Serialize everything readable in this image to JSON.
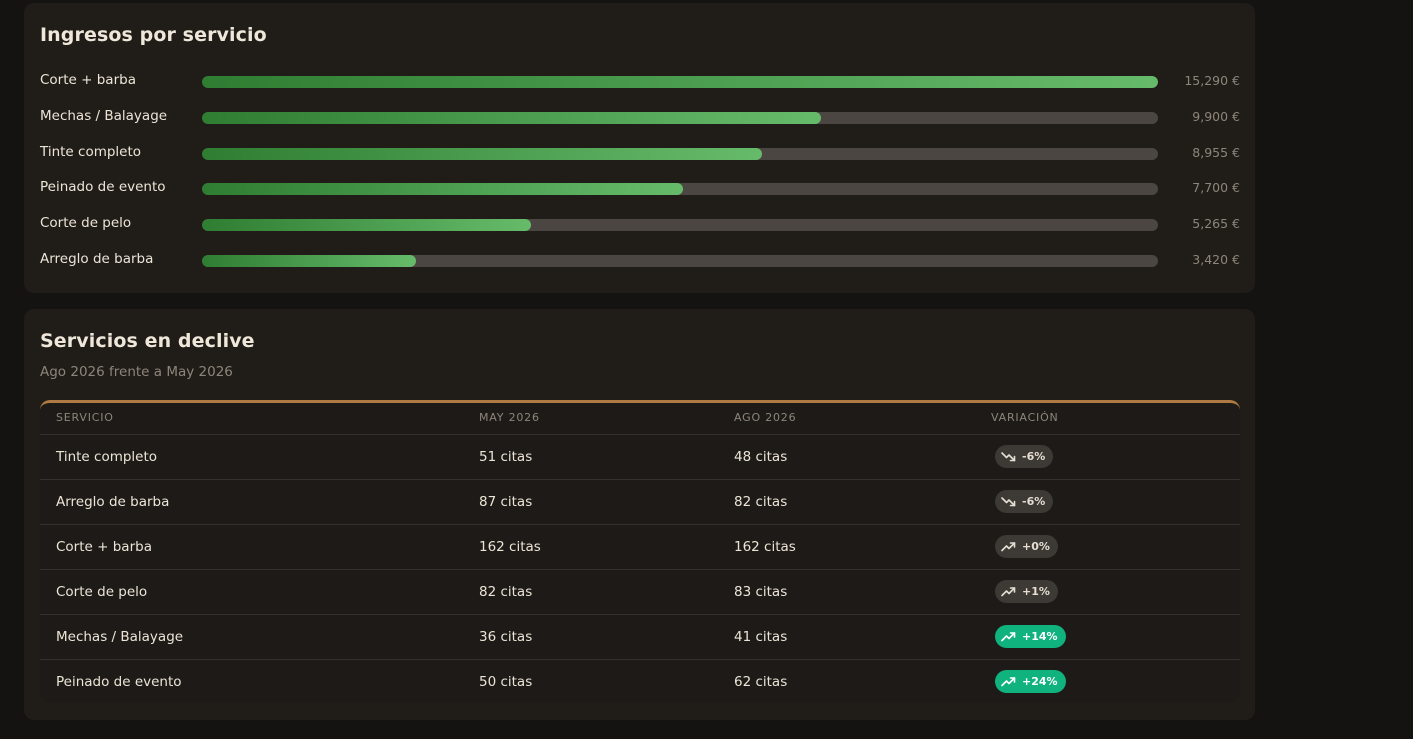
{
  "revenue": {
    "title": "Ingresos por servicio",
    "items": [
      {
        "label": "Corte + barba",
        "value": "15,290 €",
        "amount": 15290
      },
      {
        "label": "Mechas / Balayage",
        "value": "9,900 €",
        "amount": 9900
      },
      {
        "label": "Tinte completo",
        "value": "8,955 €",
        "amount": 8955
      },
      {
        "label": "Peinado de evento",
        "value": "7,700 €",
        "amount": 7700
      },
      {
        "label": "Corte de pelo",
        "value": "5,265 €",
        "amount": 5265
      },
      {
        "label": "Arreglo de barba",
        "value": "3,420 €",
        "amount": 3420
      }
    ]
  },
  "decline": {
    "title": "Servicios en declive",
    "subtitle": "Ago 2026 frente a May 2026",
    "columns": [
      "SERVICIO",
      "MAY 2026",
      "AGO 2026",
      "VARIACIÓN"
    ],
    "rows": [
      {
        "service": "Tinte completo",
        "may": "51 citas",
        "ago": "48 citas",
        "variation": "-6%",
        "trend": "down",
        "style": "neutral"
      },
      {
        "service": "Arreglo de barba",
        "may": "87 citas",
        "ago": "82 citas",
        "variation": "-6%",
        "trend": "down",
        "style": "neutral"
      },
      {
        "service": "Corte + barba",
        "may": "162 citas",
        "ago": "162 citas",
        "variation": "+0%",
        "trend": "up",
        "style": "neutral"
      },
      {
        "service": "Corte de pelo",
        "may": "82 citas",
        "ago": "83 citas",
        "variation": "+1%",
        "trend": "up",
        "style": "neutral"
      },
      {
        "service": "Mechas / Balayage",
        "may": "36 citas",
        "ago": "41 citas",
        "variation": "+14%",
        "trend": "up",
        "style": "up"
      },
      {
        "service": "Peinado de evento",
        "may": "50 citas",
        "ago": "62 citas",
        "variation": "+24%",
        "trend": "up",
        "style": "up"
      }
    ]
  },
  "colors": {
    "bar_start": "#2f7d32",
    "bar_end": "#66bb6a",
    "accent_border": "#b07a45",
    "positive_badge": "#10b37e",
    "neutral_badge": "#3d3935"
  },
  "icons": {
    "down": "trending-down-icon",
    "up": "trending-up-icon"
  }
}
